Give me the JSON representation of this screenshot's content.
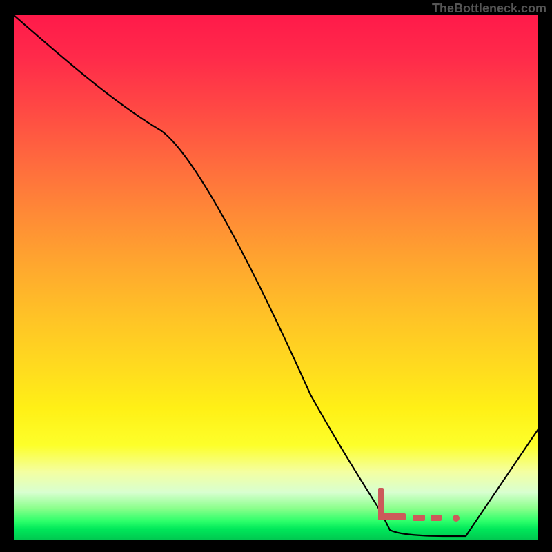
{
  "watermark": "TheBottleneck.com",
  "chart_data": {
    "type": "line",
    "title": "",
    "xlabel": "",
    "ylabel": "",
    "x": [
      0,
      0.28,
      0.7,
      0.79,
      0.82,
      0.86,
      1.0
    ],
    "values": [
      1.0,
      0.78,
      0.1,
      0.005,
      0.005,
      0.005,
      0.21
    ],
    "xlim": [
      0,
      1
    ],
    "ylim": [
      0,
      1
    ],
    "markers": {
      "x": [
        0.7,
        0.71,
        0.72,
        0.73,
        0.78,
        0.8,
        0.85
      ],
      "y": [
        0.08,
        0.04,
        0.015,
        0.01,
        0.01,
        0.01,
        0.01
      ],
      "color": "#cc5a5a"
    },
    "gradient": {
      "top": "#ff1a4a",
      "mid": "#ffdd1e",
      "bottom": "#00c850"
    }
  }
}
